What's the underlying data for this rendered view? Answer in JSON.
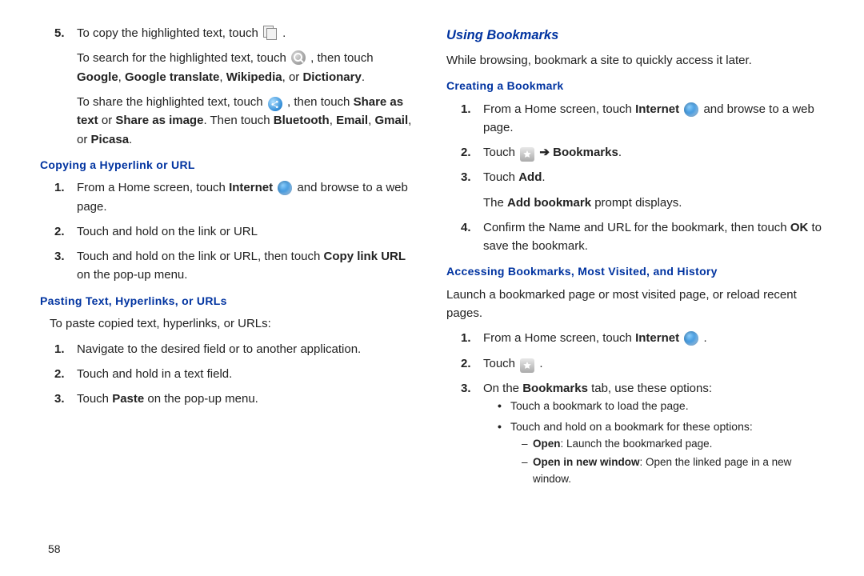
{
  "page_number": "58",
  "left": {
    "step5": {
      "l1a": "To copy the highlighted text, touch",
      "l1b": ".",
      "l2a": "To search for the highlighted text, touch",
      "l2b": ", then touch",
      "l2c": "Google",
      "l2d": ",",
      "l2e": "Google translate",
      "l2f": ",",
      "l2g": "Wikipedia",
      "l2h": ", or",
      "l2i": "Dictionary",
      "l2j": ".",
      "l3a": "To share the highlighted text, touch",
      "l3b": ", then touch",
      "l3c": "Share as text",
      "l3d": " or",
      "l3e": "Share as image",
      "l3f": ". Then touch",
      "l3g": "Bluetooth",
      "l3h": ",",
      "l3i": "Email",
      "l3j": ",",
      "l3k": "Gmail",
      "l3l": ", or",
      "l3m": "Picasa",
      "l3n": "."
    },
    "h_copy": "Copying a Hyperlink or URL",
    "copy": {
      "s1a": "From a Home screen, touch",
      "s1b": "Internet",
      "s1c": "and browse to a web page.",
      "s2": "Touch and hold on the link or URL",
      "s3a": "Touch and hold on the link or URL, then touch",
      "s3b": "Copy link URL",
      "s3c": " on the pop-up menu."
    },
    "h_paste": "Pasting Text, Hyperlinks, or URLs",
    "paste_intro": "To paste copied text, hyperlinks, or URLs:",
    "paste": {
      "s1": "Navigate to the desired field or to another application.",
      "s2": "Touch and hold in a text field.",
      "s3a": "Touch",
      "s3b": "Paste",
      "s3c": " on the pop-up menu."
    }
  },
  "right": {
    "h_using": "Using Bookmarks",
    "intro": "While browsing, bookmark a site to quickly access it later.",
    "h_create": "Creating a Bookmark",
    "create": {
      "s1a": "From a Home screen, touch",
      "s1b": "Internet",
      "s1c": "and browse to a web page.",
      "s2a": "Touch",
      "s2arrow": "➔",
      "s2b": "Bookmarks",
      "s2c": ".",
      "s3a": "Touch",
      "s3b": "Add",
      "s3c": ".",
      "s3d": "The",
      "s3e": "Add bookmark",
      "s3f": " prompt displays.",
      "s4a": "Confirm the Name and URL for the bookmark, then touch",
      "s4b": "OK",
      "s4c": " to save the bookmark."
    },
    "h_access": "Accessing Bookmarks, Most Visited, and History",
    "access_intro": "Launch a bookmarked page or most visited page, or reload recent pages.",
    "access": {
      "s1a": "From a Home screen, touch",
      "s1b": "Internet",
      "s1c": ".",
      "s2a": "Touch",
      "s2b": ".",
      "s3a": "On the",
      "s3b": "Bookmarks",
      "s3c": " tab, use these options:",
      "b1": "Touch a bookmark to load the page.",
      "b2": "Touch and hold on a bookmark for these options:",
      "d1a": "Open",
      "d1b": ": Launch the bookmarked page.",
      "d2a": "Open in new window",
      "d2b": ": Open the linked page in a new window."
    }
  }
}
